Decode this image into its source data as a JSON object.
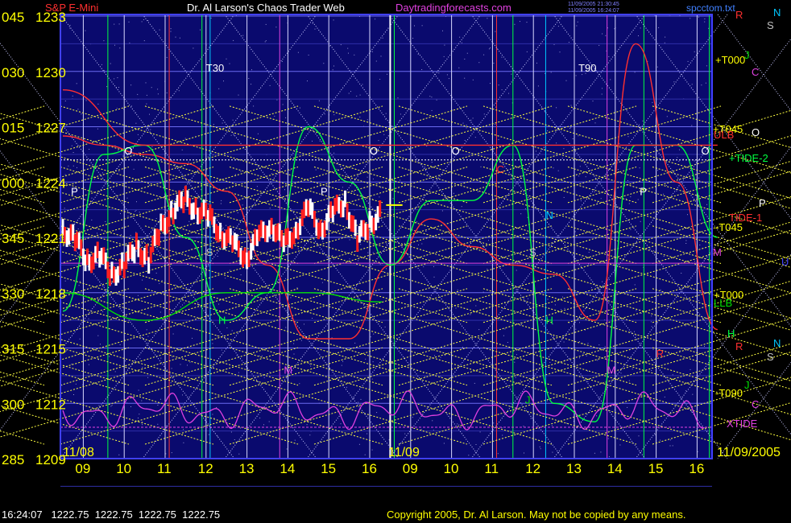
{
  "chart_data": {
    "type": "line",
    "title": {
      "symbol": "S&P E-Mini",
      "main": "Dr. Al Larson's Chaos Trader Web",
      "site": "Daytradingforecasts.com",
      "file": "spcctom.txt",
      "stamp_line1": "11/09/2005 21:30:45",
      "stamp_line2": "11/09/2005 16:24:07"
    },
    "y_axis": {
      "ylim": [
        1209,
        1233
      ],
      "ticks": [
        {
          "angle": "045",
          "price": "1233"
        },
        {
          "angle": "030",
          "price": "1230"
        },
        {
          "angle": "015",
          "price": "1227"
        },
        {
          "angle": "000",
          "price": "1224"
        },
        {
          "angle": "345",
          "price": "1221"
        },
        {
          "angle": "330",
          "price": "1218"
        },
        {
          "angle": "315",
          "price": "1215"
        },
        {
          "angle": "300",
          "price": "1212"
        },
        {
          "angle": "285",
          "price": "1209"
        }
      ]
    },
    "x_axis": {
      "hours": [
        "09",
        "10",
        "11",
        "12",
        "13",
        "14",
        "15",
        "16",
        "09",
        "10",
        "11",
        "12",
        "13",
        "14",
        "15",
        "16"
      ],
      "date_labels": [
        "11/08",
        "11/09",
        "11/09/2005"
      ]
    },
    "right_labels": [
      {
        "text": "N",
        "color": "#00c8ff"
      },
      {
        "text": "R",
        "color": "#ff3030"
      },
      {
        "text": "S",
        "color": "#c0c0c0"
      },
      {
        "text": "+T000",
        "color": "#ffff00"
      },
      {
        "text": "J",
        "color": "#00e000"
      },
      {
        "text": "C",
        "color": "#e040e0"
      },
      {
        "text": "+T045",
        "color": "#ffff00"
      },
      {
        "text": "O",
        "color": "#ffffff"
      },
      {
        "text": "ULB",
        "color": "#ff3030"
      },
      {
        "text": "+TIDE-2",
        "color": "#00ff40"
      },
      {
        "text": "P",
        "color": "#ffffff"
      },
      {
        "text": "TIDE-1",
        "color": "#ff3030"
      },
      {
        "text": "-T045",
        "color": "#ffff00"
      },
      {
        "text": "M",
        "color": "#e040e0"
      },
      {
        "text": "U",
        "color": "#4040ff"
      },
      {
        "text": "+T000",
        "color": "#ffff00"
      },
      {
        "text": "LLB",
        "color": "#00e000"
      },
      {
        "text": "H",
        "color": "#00ff40"
      },
      {
        "text": "N",
        "color": "#00c8ff"
      },
      {
        "text": "R",
        "color": "#ff3030"
      },
      {
        "text": "S",
        "color": "#c0c0c0"
      },
      {
        "text": "J",
        "color": "#00e000"
      },
      {
        "text": "-T090",
        "color": "#ffff00"
      },
      {
        "text": "C",
        "color": "#e040e0"
      },
      {
        "text": "XTIDE",
        "color": "#e040e0"
      }
    ],
    "plot_marks": [
      {
        "text": "T30",
        "color": "#ffffff"
      },
      {
        "text": "T90",
        "color": "#ffffff"
      },
      {
        "text": "O",
        "color": "#ffffff"
      },
      {
        "text": "O",
        "color": "#ffffff"
      },
      {
        "text": "O",
        "color": "#ffffff"
      },
      {
        "text": "O",
        "color": "#ffffff"
      },
      {
        "text": "P",
        "color": "#ffffff"
      },
      {
        "text": "P",
        "color": "#ffffff"
      },
      {
        "text": "P",
        "color": "#ffffff"
      },
      {
        "text": "C",
        "color": "#ff3030"
      },
      {
        "text": "N",
        "color": "#00c8ff"
      },
      {
        "text": "S",
        "color": "#c0c0c0"
      },
      {
        "text": "S",
        "color": "#c0c0c0"
      },
      {
        "text": "H",
        "color": "#00ff40"
      },
      {
        "text": "H",
        "color": "#00ff40"
      },
      {
        "text": "M",
        "color": "#e040e0"
      },
      {
        "text": "M",
        "color": "#e040e0"
      },
      {
        "text": "R",
        "color": "#ff3030"
      },
      {
        "text": "J",
        "color": "#00e000"
      }
    ],
    "series": [
      {
        "name": "TIDE-1",
        "color": "#ff3030",
        "t": [
          0,
          1,
          2,
          3,
          4,
          5,
          6,
          7,
          8,
          9,
          10,
          11,
          12,
          13,
          14,
          15,
          16
        ],
        "values": [
          1226.5,
          1226,
          1225.5,
          1225,
          1223.5,
          1219.5,
          1215.5,
          1215.5,
          1219.5,
          1222,
          1220.5,
          1219.5,
          1219,
          1216.5,
          1231.5,
          1224,
          1216
        ]
      },
      {
        "name": "+TIDE-2",
        "color": "#00ff40",
        "t": [
          0,
          1,
          2,
          3,
          4,
          5,
          6,
          7,
          8,
          9,
          10,
          11,
          12,
          13,
          14,
          15,
          16
        ],
        "values": [
          1217,
          1225.5,
          1226,
          1221,
          1216.5,
          1218,
          1227,
          1224,
          1219.5,
          1223,
          1223,
          1226,
          1212,
          1211,
          1226,
          1226,
          1221
        ]
      },
      {
        "name": "ULB",
        "color": "#ff3030",
        "t": [
          0,
          2,
          4,
          6,
          8,
          16
        ],
        "values": [
          1229,
          1226,
          1226,
          1226,
          1226,
          1226
        ]
      },
      {
        "name": "LLB",
        "color": "#00e000",
        "t": [
          0,
          2,
          4,
          6,
          7.8
        ],
        "values": [
          1218,
          1216.5,
          1218,
          1218,
          1217.5
        ]
      },
      {
        "name": "XTIDE",
        "color": "#e040e0",
        "wave": true
      }
    ],
    "price_bars": {
      "t": [
        0,
        0.3,
        0.6,
        0.9,
        1.2,
        1.5,
        1.8,
        2.1,
        2.4,
        2.7,
        3.0,
        3.3,
        3.6,
        3.9,
        4.2,
        4.5,
        4.8,
        5.1,
        5.4,
        5.7,
        6.0,
        6.3,
        6.6,
        6.9,
        7.2,
        7.5,
        7.8
      ],
      "values": [
        1221.5,
        1220.8,
        1219.8,
        1220.0,
        1219.0,
        1219.5,
        1220.5,
        1219.8,
        1221.5,
        1222.5,
        1223.0,
        1222.5,
        1222.0,
        1221.2,
        1220.5,
        1220.0,
        1221.0,
        1221.8,
        1220.5,
        1221.5,
        1222.5,
        1221.5,
        1222.3,
        1223.0,
        1220.8,
        1221.8,
        1222.3
      ],
      "last": "1222.75"
    },
    "fans": {
      "levels": [
        1225.5,
        1222.2,
        1219,
        1215.6,
        1212.4
      ]
    },
    "grid": true
  },
  "status": {
    "time": "16:24:07",
    "open": "1222.75",
    "high": "1222.75",
    "low": "1222.75",
    "close": "1222.75"
  },
  "copyright": "Copyright 2005, Dr. Al Larson. May not be copied by any means."
}
